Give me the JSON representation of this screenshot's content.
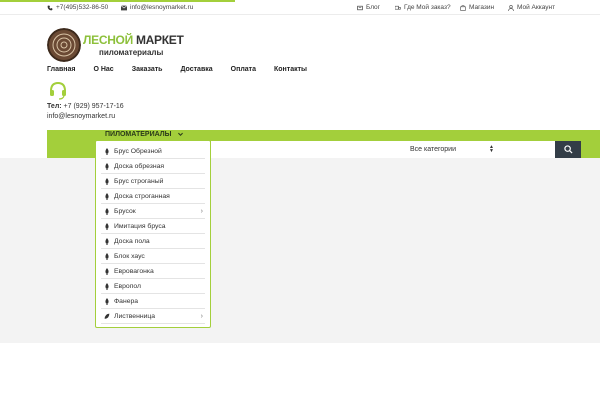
{
  "topbar": {
    "phone": "+7(495)532-86-50",
    "email": "info@lesnoymarket.ru",
    "links": [
      {
        "label": "Блог",
        "icon": "blog-icon"
      },
      {
        "label": "Где Мой заказ?",
        "icon": "truck-icon"
      },
      {
        "label": "Магазин",
        "icon": "bag-icon"
      },
      {
        "label": "Мой Аккаунт",
        "icon": "user-icon"
      }
    ]
  },
  "logo": {
    "line1a": "ЛЕСНОЙ",
    "line1b": " МАРКЕТ",
    "line2": "пиломатериалы"
  },
  "nav": [
    "Главная",
    "О Нас",
    "Заказать",
    "Доставка",
    "Оплата",
    "Контакты"
  ],
  "contact": {
    "tel_label": "Тел:",
    "tel": " +7 (929) 957-17-16",
    "email": "info@lesnoymarket.ru"
  },
  "category_button": {
    "label": "ПИЛОМАТЕРИАЛЫ"
  },
  "search": {
    "category_label": "Все категории"
  },
  "menu": [
    {
      "label": "Брус Обрезной",
      "submenu": false
    },
    {
      "label": "Доска обрезная",
      "submenu": false
    },
    {
      "label": "Брус строганый",
      "submenu": false
    },
    {
      "label": "Доска строганная",
      "submenu": false
    },
    {
      "label": "Брусок",
      "submenu": true
    },
    {
      "label": "Имитация бруса",
      "submenu": false
    },
    {
      "label": "Доска пола",
      "submenu": false
    },
    {
      "label": "Блок хаус",
      "submenu": false
    },
    {
      "label": "Евровагонка",
      "submenu": false
    },
    {
      "label": "Европол",
      "submenu": false
    },
    {
      "label": "Фанера",
      "submenu": false
    },
    {
      "label": "Лиственница",
      "submenu": true
    }
  ],
  "colors": {
    "accent": "#a3cf3b",
    "search_button": "#333d47"
  }
}
